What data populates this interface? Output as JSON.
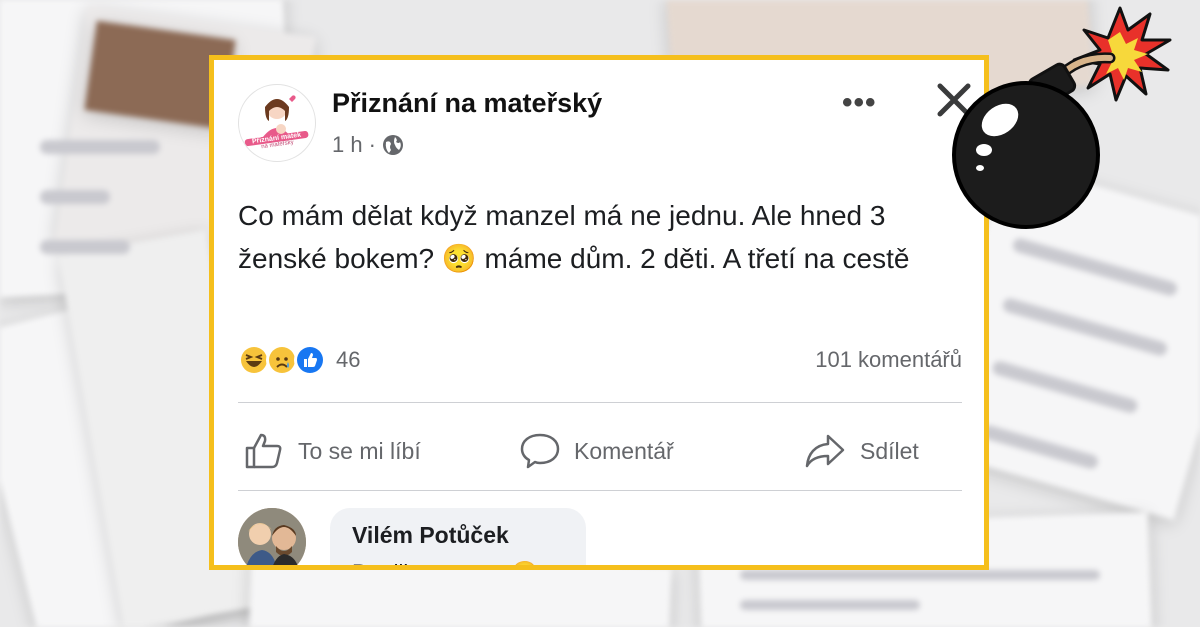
{
  "post": {
    "page_name": "Přiznání na mateřský",
    "time": "1 h",
    "separator": "·",
    "text_part1": "Co mám dělat když manzel má ne jednu. Ale hned 3 ženské bokem? ",
    "text_emoji": "🥺",
    "text_part2": " máme dům. 2 děti. A třetí na cestě",
    "reaction_count": "46",
    "comment_count": "101 komentářů",
    "more_label": "•••"
  },
  "avatar_logo": {
    "line1": "Přiznání matek",
    "line2": "na mateřský"
  },
  "actions": {
    "like": "To se mi líbí",
    "comment": "Komentář",
    "share": "Sdílet"
  },
  "comment": {
    "author": "Vilém Potůček",
    "text": "Prodliny za ro... 😉"
  },
  "colors": {
    "frame": "#f5bf1c",
    "meta": "#65676b",
    "like_blue": "#1877f2"
  }
}
